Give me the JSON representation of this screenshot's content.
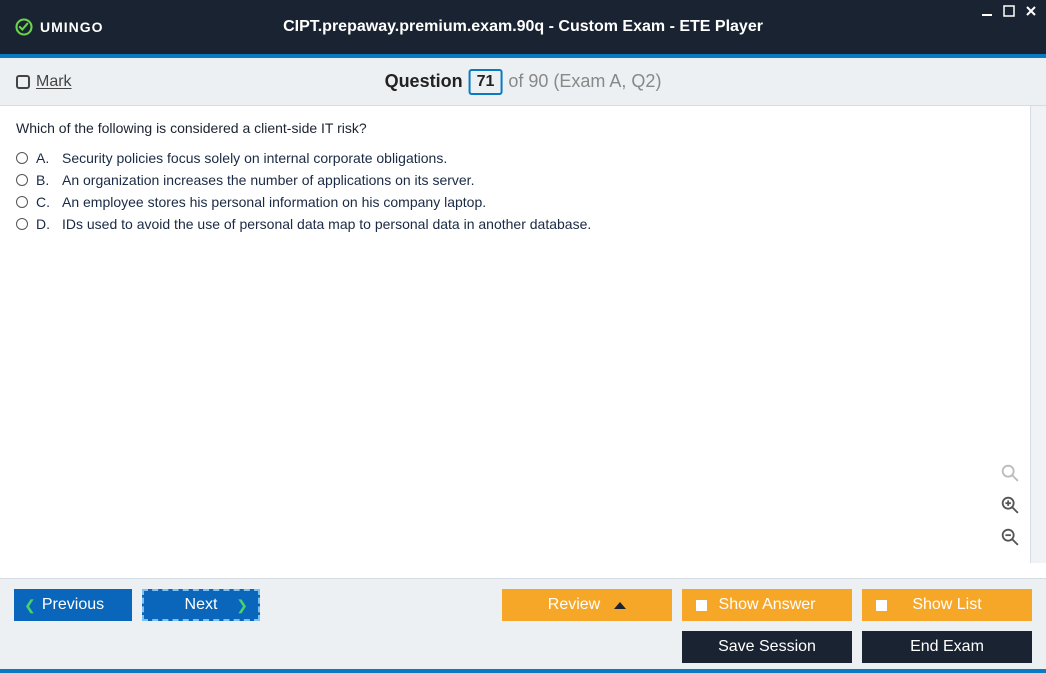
{
  "logo_text": "UMINGO",
  "window_title": "CIPT.prepaway.premium.exam.90q - Custom Exam - ETE Player",
  "mark_label": "Mark",
  "question_word": "Question",
  "question_number": "71",
  "question_total_prefix": "of 90 (Exam A, Q2)",
  "question_text": "Which of the following is considered a client-side IT risk?",
  "answers": [
    {
      "letter": "A.",
      "text": "Security policies focus solely on internal corporate obligations."
    },
    {
      "letter": "B.",
      "text": "An organization increases the number of applications on its server."
    },
    {
      "letter": "C.",
      "text": "An employee stores his personal information on his company laptop."
    },
    {
      "letter": "D.",
      "text": "IDs used to avoid the use of personal data map to personal data in another database."
    }
  ],
  "buttons": {
    "previous": "Previous",
    "next": "Next",
    "review": "Review",
    "show_answer": "Show Answer",
    "show_list": "Show List",
    "save_session": "Save Session",
    "end_exam": "End Exam"
  }
}
